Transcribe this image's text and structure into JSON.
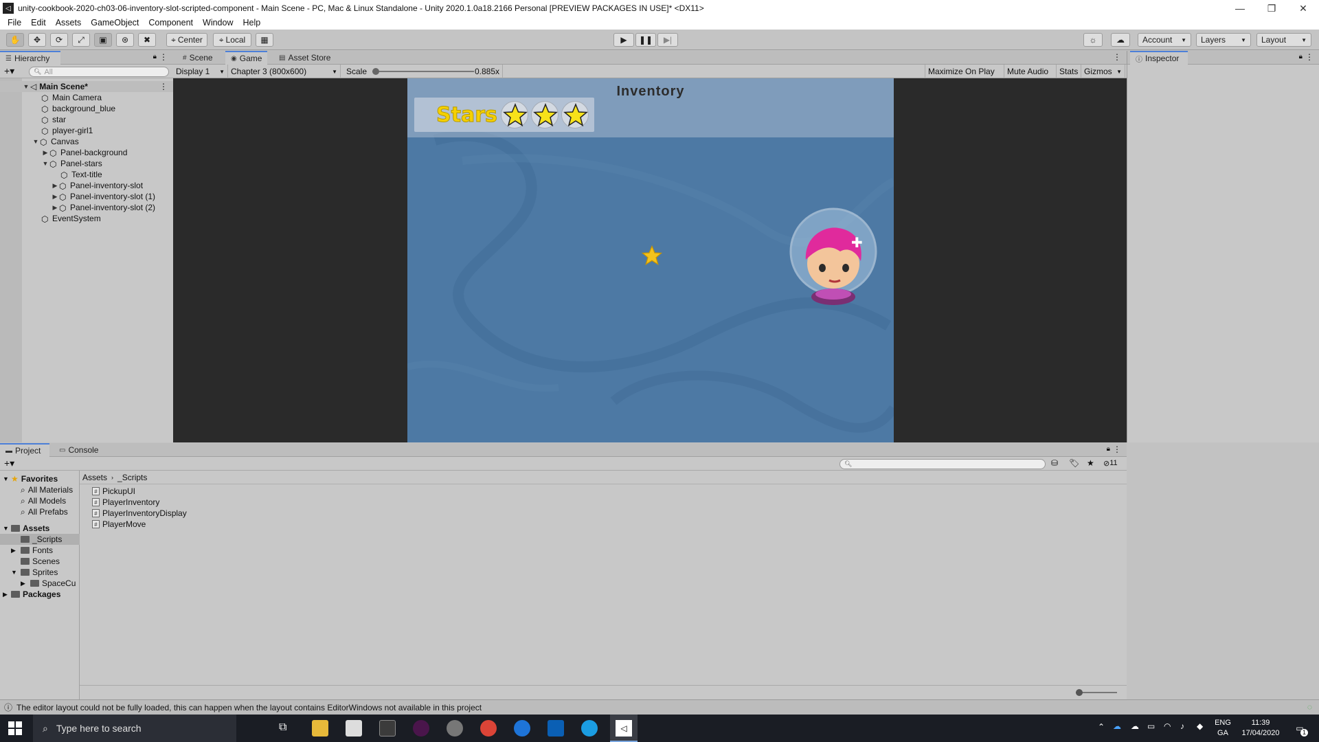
{
  "window": {
    "title": "unity-cookbook-2020-ch03-06-inventory-slot-scripted-component - Main Scene - PC, Mac & Linux Standalone - Unity 2020.1.0a18.2166 Personal [PREVIEW PACKAGES IN USE]* <DX11>",
    "minimize": "—",
    "restore": "❐",
    "close": "✕"
  },
  "menu": [
    "File",
    "Edit",
    "Assets",
    "GameObject",
    "Component",
    "Window",
    "Help"
  ],
  "toolbar": {
    "pivot": "Center",
    "space": "Local",
    "account": "Account",
    "layers": "Layers",
    "layout": "Layout"
  },
  "hierarchy": {
    "tab": "Hierarchy",
    "search_placeholder": "All",
    "items": [
      {
        "label": "Main Scene*"
      },
      {
        "label": "Main Camera"
      },
      {
        "label": "background_blue"
      },
      {
        "label": "star"
      },
      {
        "label": "player-girl1"
      },
      {
        "label": "Canvas"
      },
      {
        "label": "Panel-background"
      },
      {
        "label": "Panel-stars"
      },
      {
        "label": "Text-title"
      },
      {
        "label": "Panel-inventory-slot"
      },
      {
        "label": "Panel-inventory-slot (1)"
      },
      {
        "label": "Panel-inventory-slot (2)"
      },
      {
        "label": "EventSystem"
      }
    ]
  },
  "game": {
    "tabs": [
      "Scene",
      "Game",
      "Asset Store"
    ],
    "display": "Display 1",
    "resolution": "Chapter 3 (800x600)",
    "scale_label": "Scale",
    "scale_value": "0.885x",
    "maximize": "Maximize On Play",
    "mute": "Mute Audio",
    "stats": "Stats",
    "gizmos": "Gizmos",
    "inventory_title": "Inventory",
    "stars_label": "Stars"
  },
  "inspector": {
    "tab": "Inspector"
  },
  "project": {
    "tabs": [
      "Project",
      "Console"
    ],
    "hidden_count": "11",
    "breadcrumb": [
      "Assets",
      "_Scripts"
    ],
    "favorites_label": "Favorites",
    "favorites": [
      "All Materials",
      "All Models",
      "All Prefabs"
    ],
    "assets_label": "Assets",
    "folders": [
      "_Scripts",
      "Fonts",
      "Scenes",
      "Sprites",
      "SpaceCu"
    ],
    "packages_label": "Packages",
    "scripts": [
      "PickupUI",
      "PlayerInventory",
      "PlayerInventoryDisplay",
      "PlayerMove"
    ]
  },
  "status": "The editor layout could not be fully loaded, this can happen when the layout contains EditorWindows not available in this project",
  "taskbar": {
    "search_placeholder": "Type here to search",
    "lang_top": "ENG",
    "lang_bottom": "GA",
    "time": "11:39",
    "date": "17/04/2020",
    "notif_count": "1"
  },
  "colors": {
    "accent": "#4c7fd8",
    "game_bg": "#4d79a4",
    "star_yellow": "#f5d000"
  }
}
